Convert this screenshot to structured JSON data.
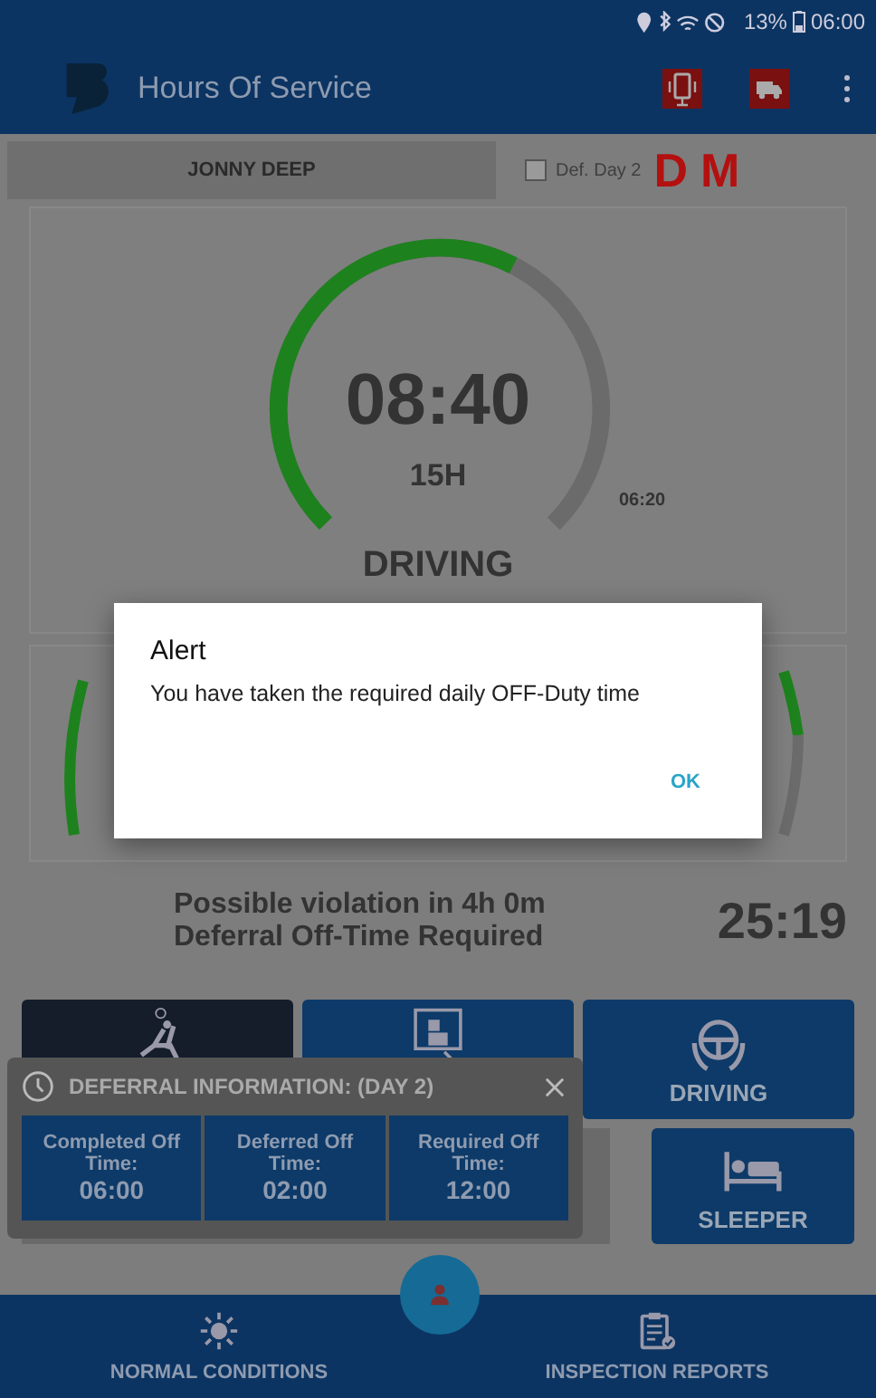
{
  "status_bar": {
    "battery": "13%",
    "time": "06:00"
  },
  "app_bar": {
    "title": "Hours Of Service"
  },
  "driver_bar": {
    "driver": "JONNY DEEP",
    "deferral": {
      "label": "Def. Day 2",
      "checked": false
    },
    "badges": [
      "D",
      "M"
    ]
  },
  "gauge": {
    "time": "08:40",
    "cycle": "15H",
    "remaining": "06:20",
    "status": "DRIVING",
    "level": 0.6
  },
  "violation": {
    "lines": [
      "Possible violation in 4h 0m",
      "Deferral Off-Time Required"
    ],
    "timer": "25:19"
  },
  "duty_buttons": [
    {
      "kind": "off_duty",
      "selected": true
    },
    {
      "kind": "on_duty",
      "selected": false
    },
    {
      "kind": "driving",
      "label": "DRIVING",
      "selected": false
    },
    {
      "kind": "sleeper",
      "label": "SLEEPER",
      "selected": false
    }
  ],
  "deferral_info": {
    "title": "DEFERRAL INFORMATION: (DAY 2)",
    "cells": [
      {
        "label": "Completed Off Time:",
        "value": "06:00"
      },
      {
        "label": "Deferred Off Time:",
        "value": "02:00"
      },
      {
        "label": "Required Off Time:",
        "value": "12:00"
      }
    ]
  },
  "bottom_nav": [
    {
      "kind": "conditions",
      "label": "NORMAL CONDITIONS"
    },
    {
      "kind": "reports",
      "label": "INSPECTION REPORTS"
    }
  ],
  "dialog": {
    "title": "Alert",
    "message": "You have taken the required daily OFF-Duty time",
    "button": "OK"
  }
}
